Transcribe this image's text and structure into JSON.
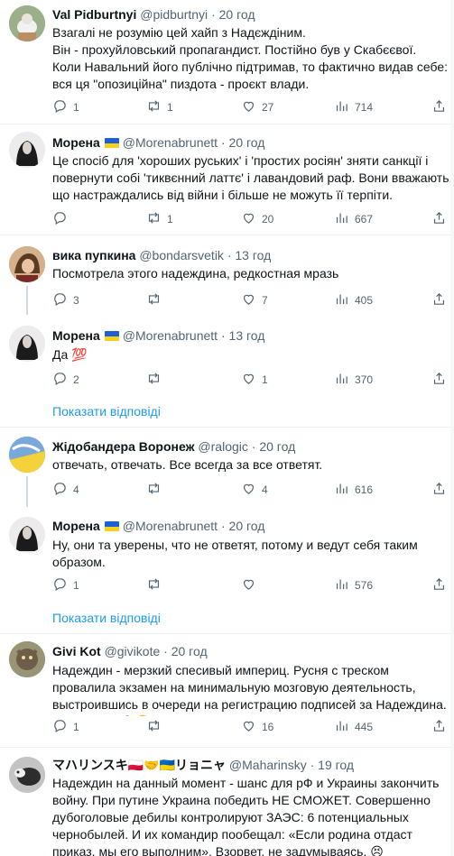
{
  "icons": {
    "reply": "reply-icon",
    "retweet": "retweet-icon",
    "like": "like-icon",
    "views": "views-icon",
    "share": "share-icon"
  },
  "show_replies_label": "Показати відповіді",
  "tweets": [
    {
      "name": "Val Pidburtnyi",
      "handle": "@pidburtnyi",
      "time": "20 год",
      "text": "Взагалі не розумію цей хайп з Надєждіним.\nВін - прохуйловський пропагандист. Постійно був у Скабєєвої.\nКоли Навальний його публічно підтримав, то фактично видав себе: вся ця \"опозиційна\" пиздота - проєкт влади.",
      "replies": "1",
      "retweets": "1",
      "likes": "27",
      "views": "714"
    },
    {
      "name": "Морена",
      "handle": "@Morenabrunett",
      "time": "20 год",
      "text": "Це спосіб для 'хороших руських' і 'простих росіян' зняти санкції і повернути собі 'тиквєнний латтє' і лавандовий раф. Вони вважають, що настраждались від війни і більше не можуть її терпіти.",
      "replies": "",
      "retweets": "1",
      "likes": "20",
      "views": "667"
    },
    {
      "name": "вика пупкина",
      "handle": "@bondarsvetik",
      "time": "13 год",
      "text": "Посмотрела этого надеждина, редкостная мразь",
      "replies": "3",
      "retweets": "",
      "likes": "7",
      "views": "405"
    },
    {
      "name": "Морена",
      "handle": "@Morenabrunett",
      "time": "13 год",
      "text": "Да 💯",
      "replies": "2",
      "retweets": "",
      "likes": "1",
      "views": "370"
    },
    {
      "name": "Жідобандера Воронеж",
      "handle": "@ralogic",
      "time": "20 год",
      "text": "отвечать, отвечать. Все всегда за все ответят.",
      "replies": "4",
      "retweets": "",
      "likes": "4",
      "views": "616"
    },
    {
      "name": "Морена",
      "handle": "@Morenabrunett",
      "time": "20 год",
      "text": "Ну, они та уверены, что не ответят, потому и ведут себя таким образом.",
      "replies": "1",
      "retweets": "",
      "likes": "",
      "views": "576"
    },
    {
      "name": "Givi Kot",
      "handle": "@givikote",
      "time": "20 год",
      "text": "Надеждин - мерзкий спесивый империц. Русня с треском провалила экзамен на минимальную мозговую деятельность, выстроившись в очереди на регистрацию подписей за Надеждина. Это другое 😂🤣",
      "replies": "1",
      "retweets": "",
      "likes": "16",
      "views": "445"
    },
    {
      "name": "マハリンスキ🇵🇱🤝🇺🇦リョニャ",
      "handle": "@Maharinsky",
      "time": "19 год",
      "text": "Надеждин на данный момент - шанс для рФ и Украины закончить войну. При путине Украина победить НЕ СМОЖЕТ. Совершенно дубоголовые дебилы контролируют ЗАЭС: 6 потенциальных чернобылей. И их командир пообещал: «Если родина отдаст приказ, мы его выполним». Взорвет, не задумываясь. 😣"
    }
  ]
}
